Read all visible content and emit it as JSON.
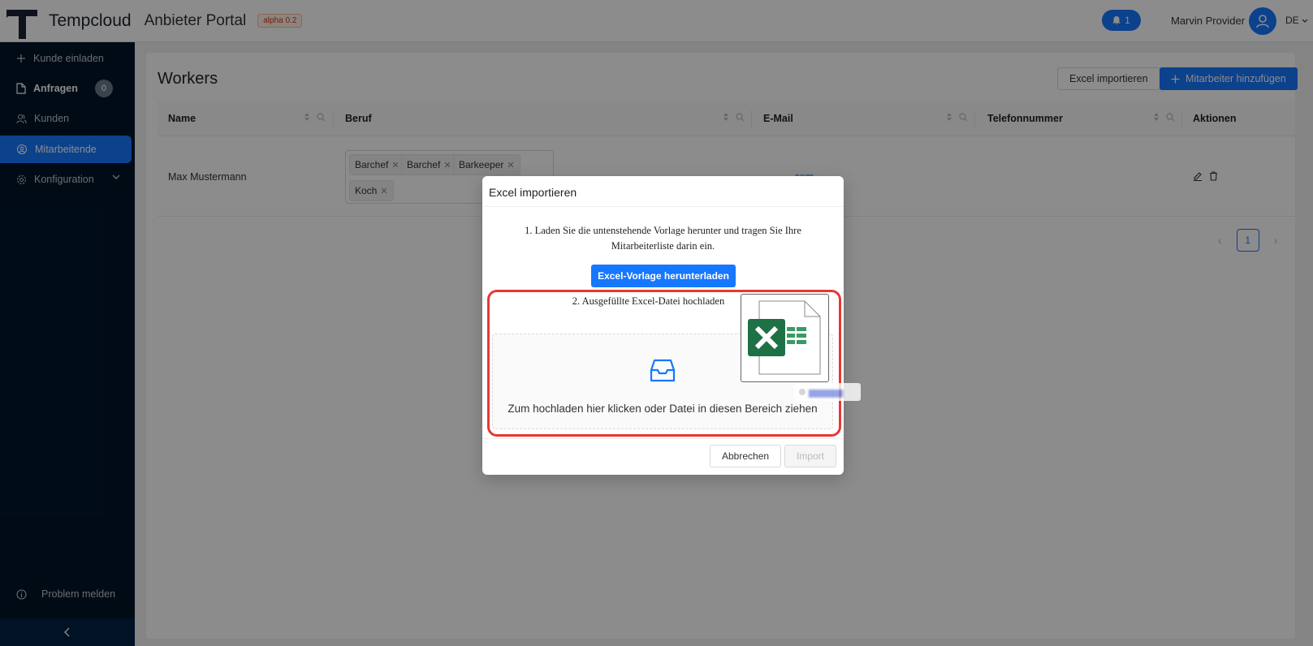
{
  "header": {
    "brand": "Tempcloud",
    "portal": "Anbieter Portal",
    "version_badge": "alpha 0.2",
    "notifications_count": "1",
    "user_name": "Marvin Provider",
    "language": "DE"
  },
  "sidebar": {
    "items": [
      {
        "label": "Kunde einladen",
        "icon": "plus-icon"
      },
      {
        "label": "Anfragen",
        "icon": "document-icon",
        "badge": "0"
      },
      {
        "label": "Kunden",
        "icon": "users-icon"
      },
      {
        "label": "Mitarbeitende",
        "icon": "team-icon"
      },
      {
        "label": "Konfiguration",
        "icon": "gear-icon"
      }
    ],
    "report_problem": "Problem melden",
    "collapse_icon": "chevron-left-icon"
  },
  "page": {
    "title": "Workers",
    "import_excel_button": "Excel importieren",
    "add_worker_button": "Mitarbeiter hinzufügen"
  },
  "table": {
    "columns": [
      "Name",
      "Beruf",
      "E-Mail",
      "Telefonnummer",
      "Aktionen"
    ],
    "rows": [
      {
        "name": "Max Mustermann",
        "jobs": [
          "Barchef",
          "Barchef",
          "Barkeeper",
          "Koch"
        ],
        "email": ".com"
      }
    ]
  },
  "pagination": {
    "current_page": "1"
  },
  "modal": {
    "title": "Excel importieren",
    "step1": "1. Laden Sie die untenstehende Vorlage herunter und tragen Sie Ihre Mitarbeiterliste darin ein.",
    "download_button": "Excel-Vorlage herunterladen",
    "step2": "2. Ausgefüllte Excel-Datei hochladen",
    "dropzone_text": "Zum hochladen hier klicken oder Datei in diesen Bereich ziehen",
    "cancel_button": "Abbrechen",
    "import_button": "Import"
  },
  "colors": {
    "primary": "#1677ff",
    "sidebar_bg": "#001529",
    "highlight": "#e53935",
    "excel_green": "#1e7145"
  }
}
